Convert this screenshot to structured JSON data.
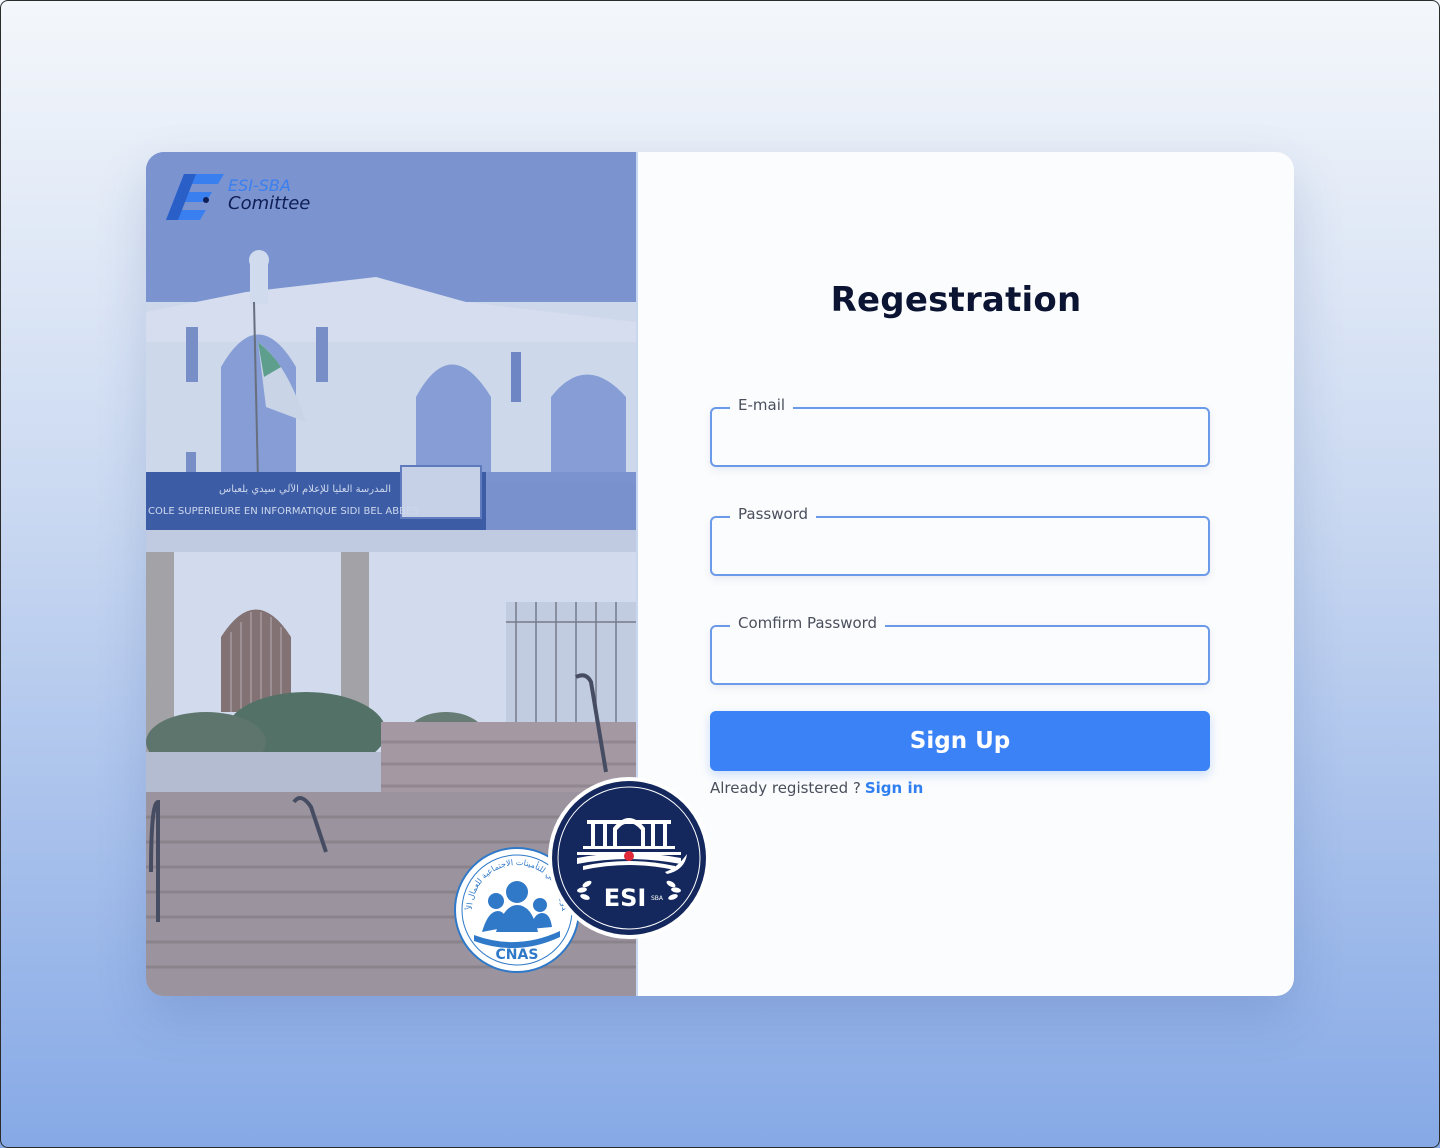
{
  "brand": {
    "line1": "ESI-SBA",
    "line2": "Comittee"
  },
  "photo": {
    "sign_arabic": "المدرسة العليا للإعلام الآلي  سيدي بلعباس",
    "sign_french": "COLE SUPERIEURE EN INFORMATIQUE   SIDI BEL ABBES"
  },
  "badges": {
    "cnas_label": "CNAS",
    "cnas_arabic": "الصندوق الوطني للتأمينات الاجتماعية للعمال الأجراء",
    "esi_label": "ESI",
    "esi_sub": "SBA"
  },
  "form": {
    "title": "Regestration",
    "email_label": "E-mail",
    "email_value": "",
    "password_label": "Password",
    "password_value": "",
    "confirm_label": "Comfirm Password",
    "confirm_value": "",
    "submit_label": "Sign Up",
    "signin_prompt": "Already registered ?",
    "signin_link": "Sign in"
  },
  "colors": {
    "accent": "#3b82f6",
    "field_border": "#6b9ae8",
    "title": "#0b1433",
    "badge_navy": "#14285e"
  }
}
